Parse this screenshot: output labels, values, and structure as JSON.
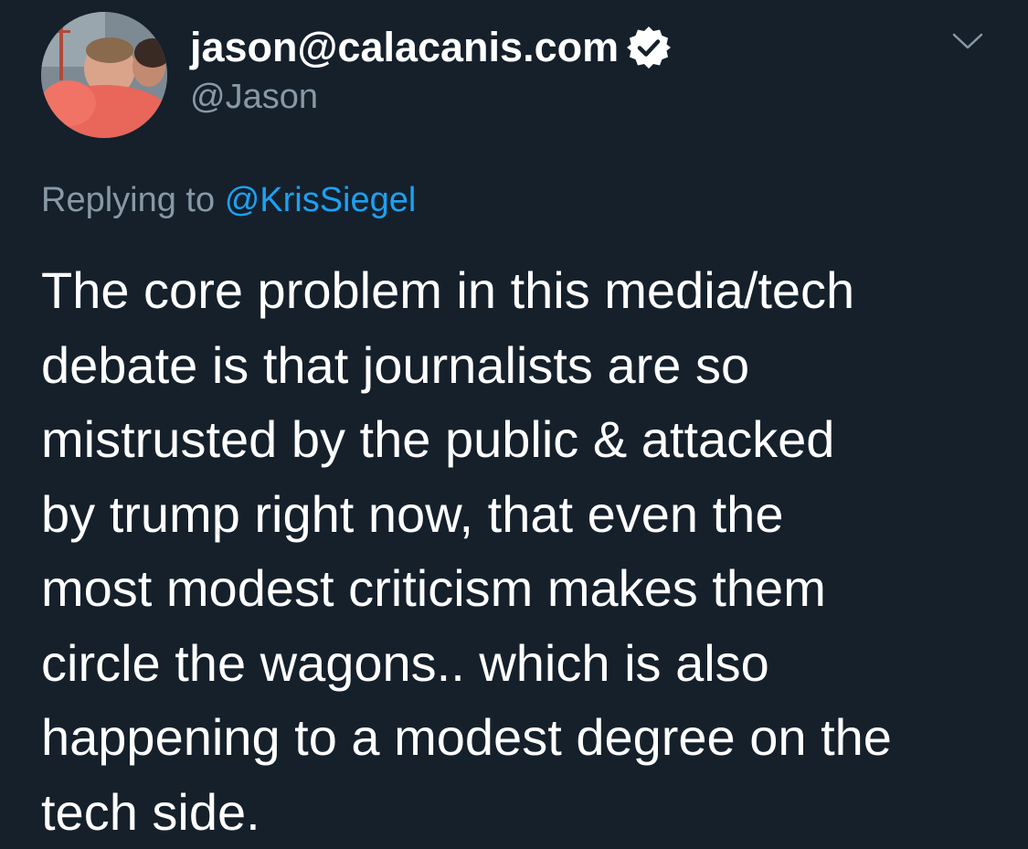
{
  "tweet": {
    "display_name": "jason@calacanis.com",
    "handle": "@Jason",
    "verified": true,
    "replying_prefix": "Replying to",
    "replying_to": "@KrisSiegel",
    "text_lines": [
      "The core problem in this media/tech",
      "debate is that journalists are so",
      "mistrusted by the public & attacked",
      "by trump right now, that even the",
      "most modest criticism makes them",
      "circle the wagons.. which is also",
      "happening to a modest degree on the",
      "tech side."
    ]
  },
  "icons": {
    "verified": "verified-badge-icon",
    "menu": "chevron-down-icon"
  },
  "colors": {
    "background": "#15202b",
    "primary_text": "#ffffff",
    "secondary_text": "#8899a6",
    "link": "#1da1f2"
  }
}
